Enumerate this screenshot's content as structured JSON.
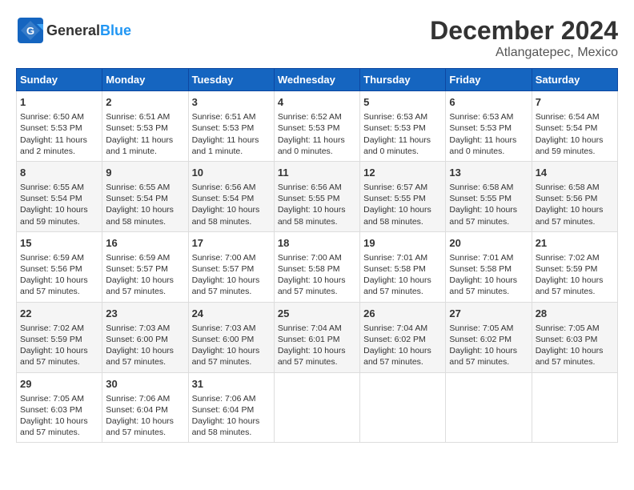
{
  "header": {
    "logo_general": "General",
    "logo_blue": "Blue",
    "title": "December 2024",
    "subtitle": "Atlangatepec, Mexico"
  },
  "columns": [
    "Sunday",
    "Monday",
    "Tuesday",
    "Wednesday",
    "Thursday",
    "Friday",
    "Saturday"
  ],
  "weeks": [
    [
      {
        "day": "1",
        "lines": [
          "Sunrise: 6:50 AM",
          "Sunset: 5:53 PM",
          "Daylight: 11 hours",
          "and 2 minutes."
        ]
      },
      {
        "day": "2",
        "lines": [
          "Sunrise: 6:51 AM",
          "Sunset: 5:53 PM",
          "Daylight: 11 hours",
          "and 1 minute."
        ]
      },
      {
        "day": "3",
        "lines": [
          "Sunrise: 6:51 AM",
          "Sunset: 5:53 PM",
          "Daylight: 11 hours",
          "and 1 minute."
        ]
      },
      {
        "day": "4",
        "lines": [
          "Sunrise: 6:52 AM",
          "Sunset: 5:53 PM",
          "Daylight: 11 hours",
          "and 0 minutes."
        ]
      },
      {
        "day": "5",
        "lines": [
          "Sunrise: 6:53 AM",
          "Sunset: 5:53 PM",
          "Daylight: 11 hours",
          "and 0 minutes."
        ]
      },
      {
        "day": "6",
        "lines": [
          "Sunrise: 6:53 AM",
          "Sunset: 5:53 PM",
          "Daylight: 11 hours",
          "and 0 minutes."
        ]
      },
      {
        "day": "7",
        "lines": [
          "Sunrise: 6:54 AM",
          "Sunset: 5:54 PM",
          "Daylight: 10 hours",
          "and 59 minutes."
        ]
      }
    ],
    [
      {
        "day": "8",
        "lines": [
          "Sunrise: 6:55 AM",
          "Sunset: 5:54 PM",
          "Daylight: 10 hours",
          "and 59 minutes."
        ]
      },
      {
        "day": "9",
        "lines": [
          "Sunrise: 6:55 AM",
          "Sunset: 5:54 PM",
          "Daylight: 10 hours",
          "and 58 minutes."
        ]
      },
      {
        "day": "10",
        "lines": [
          "Sunrise: 6:56 AM",
          "Sunset: 5:54 PM",
          "Daylight: 10 hours",
          "and 58 minutes."
        ]
      },
      {
        "day": "11",
        "lines": [
          "Sunrise: 6:56 AM",
          "Sunset: 5:55 PM",
          "Daylight: 10 hours",
          "and 58 minutes."
        ]
      },
      {
        "day": "12",
        "lines": [
          "Sunrise: 6:57 AM",
          "Sunset: 5:55 PM",
          "Daylight: 10 hours",
          "and 58 minutes."
        ]
      },
      {
        "day": "13",
        "lines": [
          "Sunrise: 6:58 AM",
          "Sunset: 5:55 PM",
          "Daylight: 10 hours",
          "and 57 minutes."
        ]
      },
      {
        "day": "14",
        "lines": [
          "Sunrise: 6:58 AM",
          "Sunset: 5:56 PM",
          "Daylight: 10 hours",
          "and 57 minutes."
        ]
      }
    ],
    [
      {
        "day": "15",
        "lines": [
          "Sunrise: 6:59 AM",
          "Sunset: 5:56 PM",
          "Daylight: 10 hours",
          "and 57 minutes."
        ]
      },
      {
        "day": "16",
        "lines": [
          "Sunrise: 6:59 AM",
          "Sunset: 5:57 PM",
          "Daylight: 10 hours",
          "and 57 minutes."
        ]
      },
      {
        "day": "17",
        "lines": [
          "Sunrise: 7:00 AM",
          "Sunset: 5:57 PM",
          "Daylight: 10 hours",
          "and 57 minutes."
        ]
      },
      {
        "day": "18",
        "lines": [
          "Sunrise: 7:00 AM",
          "Sunset: 5:58 PM",
          "Daylight: 10 hours",
          "and 57 minutes."
        ]
      },
      {
        "day": "19",
        "lines": [
          "Sunrise: 7:01 AM",
          "Sunset: 5:58 PM",
          "Daylight: 10 hours",
          "and 57 minutes."
        ]
      },
      {
        "day": "20",
        "lines": [
          "Sunrise: 7:01 AM",
          "Sunset: 5:58 PM",
          "Daylight: 10 hours",
          "and 57 minutes."
        ]
      },
      {
        "day": "21",
        "lines": [
          "Sunrise: 7:02 AM",
          "Sunset: 5:59 PM",
          "Daylight: 10 hours",
          "and 57 minutes."
        ]
      }
    ],
    [
      {
        "day": "22",
        "lines": [
          "Sunrise: 7:02 AM",
          "Sunset: 5:59 PM",
          "Daylight: 10 hours",
          "and 57 minutes."
        ]
      },
      {
        "day": "23",
        "lines": [
          "Sunrise: 7:03 AM",
          "Sunset: 6:00 PM",
          "Daylight: 10 hours",
          "and 57 minutes."
        ]
      },
      {
        "day": "24",
        "lines": [
          "Sunrise: 7:03 AM",
          "Sunset: 6:00 PM",
          "Daylight: 10 hours",
          "and 57 minutes."
        ]
      },
      {
        "day": "25",
        "lines": [
          "Sunrise: 7:04 AM",
          "Sunset: 6:01 PM",
          "Daylight: 10 hours",
          "and 57 minutes."
        ]
      },
      {
        "day": "26",
        "lines": [
          "Sunrise: 7:04 AM",
          "Sunset: 6:02 PM",
          "Daylight: 10 hours",
          "and 57 minutes."
        ]
      },
      {
        "day": "27",
        "lines": [
          "Sunrise: 7:05 AM",
          "Sunset: 6:02 PM",
          "Daylight: 10 hours",
          "and 57 minutes."
        ]
      },
      {
        "day": "28",
        "lines": [
          "Sunrise: 7:05 AM",
          "Sunset: 6:03 PM",
          "Daylight: 10 hours",
          "and 57 minutes."
        ]
      }
    ],
    [
      {
        "day": "29",
        "lines": [
          "Sunrise: 7:05 AM",
          "Sunset: 6:03 PM",
          "Daylight: 10 hours",
          "and 57 minutes."
        ]
      },
      {
        "day": "30",
        "lines": [
          "Sunrise: 7:06 AM",
          "Sunset: 6:04 PM",
          "Daylight: 10 hours",
          "and 57 minutes."
        ]
      },
      {
        "day": "31",
        "lines": [
          "Sunrise: 7:06 AM",
          "Sunset: 6:04 PM",
          "Daylight: 10 hours",
          "and 58 minutes."
        ]
      },
      {
        "day": "",
        "lines": []
      },
      {
        "day": "",
        "lines": []
      },
      {
        "day": "",
        "lines": []
      },
      {
        "day": "",
        "lines": []
      }
    ]
  ]
}
